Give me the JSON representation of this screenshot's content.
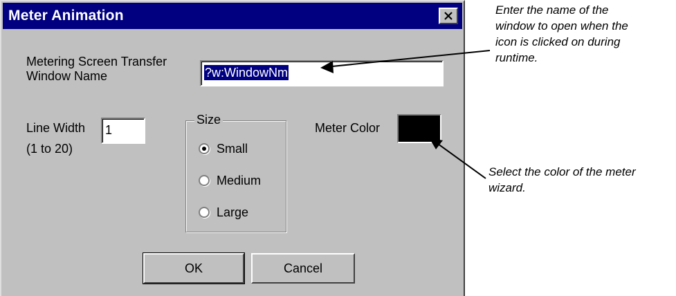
{
  "dialog": {
    "title": "Meter Animation",
    "close_icon": "close-icon",
    "window_name_label_line1": "Metering Screen Transfer",
    "window_name_label_line2": "Window Name",
    "window_name_value": "?w:WindowNm",
    "line_width_label": "Line Width",
    "line_width_range": "(1 to 20)",
    "line_width_value": "1",
    "size_group_title": "Size",
    "size_options": [
      {
        "label": "Small",
        "selected": true
      },
      {
        "label": "Medium",
        "selected": false
      },
      {
        "label": "Large",
        "selected": false
      }
    ],
    "meter_color_label": "Meter Color",
    "meter_color_value": "#000000",
    "ok_label": "OK",
    "cancel_label": "Cancel"
  },
  "annotations": {
    "window_name_note": [
      "Enter the name of the",
      "window to open when the",
      "icon is clicked on during",
      "runtime."
    ],
    "color_note": [
      "Select the color of the meter",
      "wizard."
    ]
  },
  "colors": {
    "title_bar": "#000080",
    "dialog_face": "#c0c0c0",
    "selection_highlight": "#000080"
  }
}
